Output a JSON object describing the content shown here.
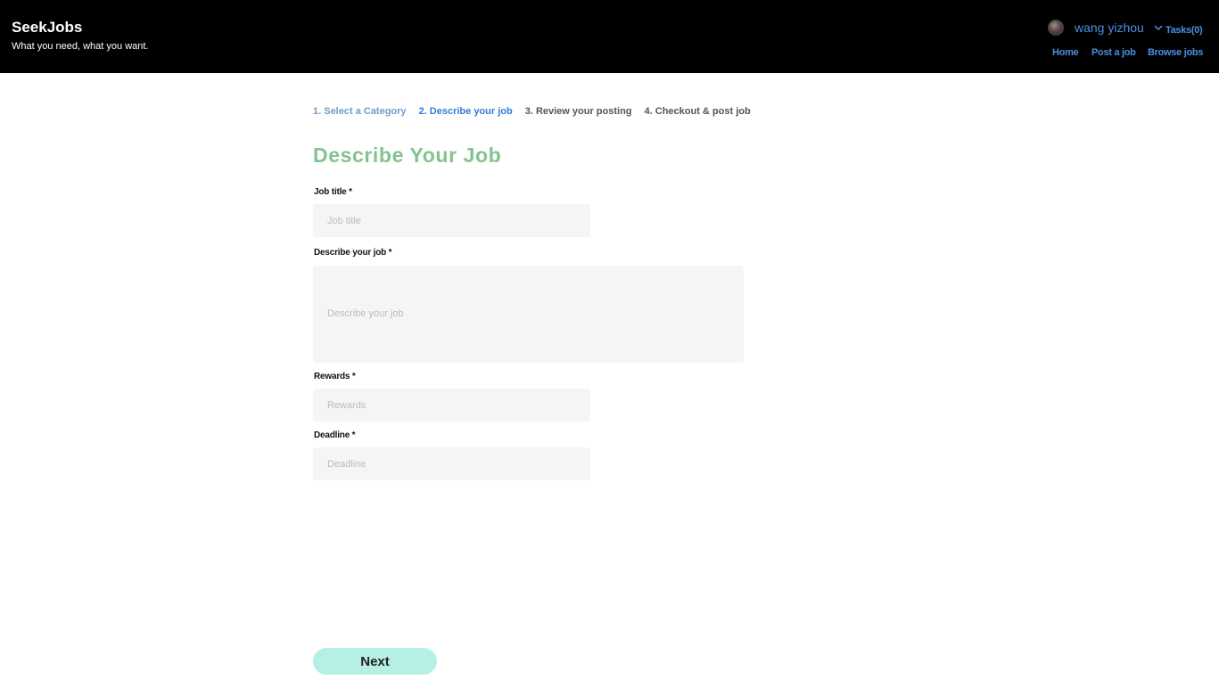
{
  "header": {
    "brand": "SeekJobs",
    "tagline": "What you need, what you want.",
    "username": "wang yizhou",
    "tasks": "Tasks(0)",
    "nav": {
      "home": "Home",
      "post": "Post a job",
      "browse": "Browse jobs"
    }
  },
  "steps": [
    {
      "label": "1. Select a Category",
      "state": "done"
    },
    {
      "label": "2. Describe your job",
      "state": "active"
    },
    {
      "label": "3. Review your posting",
      "state": "todo"
    },
    {
      "label": "4. Checkout & post job",
      "state": "todo"
    }
  ],
  "form": {
    "title": "Describe Your Job",
    "job_title": {
      "label": "Job title *",
      "placeholder": "Job title",
      "value": ""
    },
    "description": {
      "label": "Describe your job *",
      "placeholder": "Describe your job",
      "value": ""
    },
    "rewards": {
      "label": "Rewards *",
      "placeholder": "Rewards",
      "value": ""
    },
    "deadline": {
      "label": "Deadline *",
      "placeholder": "Deadline",
      "value": ""
    },
    "next_label": "Next"
  },
  "colors": {
    "link": "#4a90e2",
    "title": "#84c38e",
    "next_button": "#b6efe3",
    "header_bg": "#000000"
  },
  "icons": {
    "user_menu": "chevron-down-icon",
    "avatar": "user-avatar"
  }
}
